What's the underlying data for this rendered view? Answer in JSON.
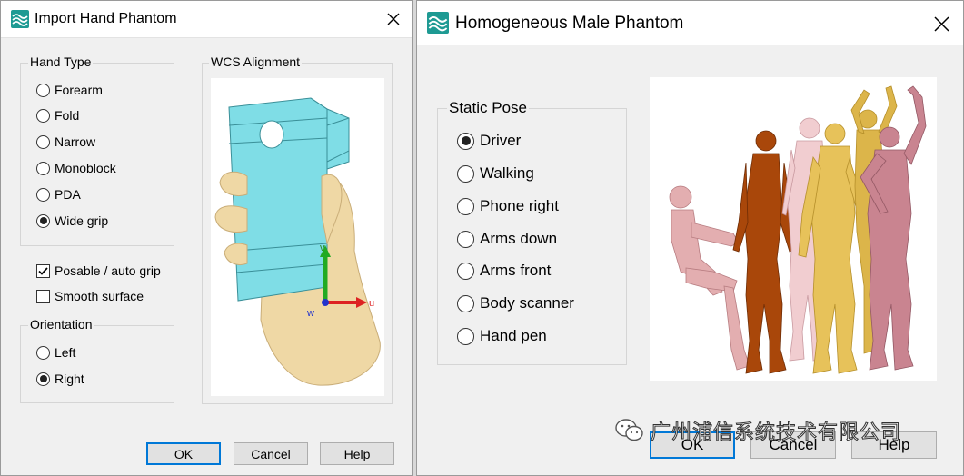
{
  "left_dialog": {
    "title": "Import Hand Phantom",
    "hand_type": {
      "label": "Hand Type",
      "options": [
        "Forearm",
        "Fold",
        "Narrow",
        "Monoblock",
        "PDA",
        "Wide grip"
      ],
      "selected": "Wide grip"
    },
    "wcs": {
      "label": "WCS Alignment",
      "axes": {
        "v": "v",
        "u": "u",
        "w": "w"
      }
    },
    "checkboxes": [
      {
        "label": "Posable / auto grip",
        "checked": true
      },
      {
        "label": "Smooth surface",
        "checked": false
      }
    ],
    "orientation": {
      "label": "Orientation",
      "options": [
        "Left",
        "Right"
      ],
      "selected": "Right"
    },
    "buttons": {
      "ok": "OK",
      "cancel": "Cancel",
      "help": "Help"
    }
  },
  "right_dialog": {
    "title": "Homogeneous Male Phantom",
    "static_pose": {
      "label": "Static Pose",
      "options": [
        "Driver",
        "Walking",
        "Phone right",
        "Arms down",
        "Arms front",
        "Body scanner",
        "Hand pen"
      ],
      "selected": "Driver"
    },
    "buttons": {
      "ok": "OK",
      "cancel": "Cancel",
      "help": "Help"
    }
  },
  "watermark": {
    "text": "广州浦信系统技术有限公司"
  },
  "icons": {
    "app": "phantom-app-icon",
    "close": "close-icon"
  },
  "colors": {
    "accent": "#0078d7",
    "app_icon": "#1e9a93",
    "device": "#7fdde6",
    "skin": "#efd8a5"
  }
}
